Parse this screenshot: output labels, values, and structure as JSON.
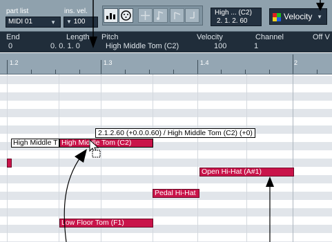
{
  "toolbar": {
    "part_list_label": "part list",
    "part_list_value": "MIDI 01",
    "ins_vel_label": "ins. vel.",
    "ins_vel_value": "100",
    "position_label": "High ... (C2)",
    "position_value": "2. 1. 2. 60",
    "controller_select": "Velocity"
  },
  "info_line": {
    "columns": [
      "End",
      "Length",
      "Pitch",
      "Velocity",
      "Channel",
      "Off V"
    ],
    "values": {
      "end": "0",
      "length": "0. 0. 1.   0",
      "pitch": "High Middle Tom (C2)",
      "velocity": "100",
      "channel": "1"
    }
  },
  "ruler": {
    "ticks": [
      "1.2",
      "1.3",
      "1.4",
      "2"
    ]
  },
  "editor": {
    "tooltip": "2.1.2.60 (+0.0.0.60) / High Middle Tom (C2) (+0)",
    "notes": {
      "ghost": "High Middle T",
      "dragged": "High Middle Tom (C2)",
      "open_hihat": "Open Hi-Hat (A#1)",
      "pedal_hihat": "Pedal Hi-Hat",
      "low_floor_tom": "Low Floor Tom (F1)"
    }
  },
  "colors": {
    "note": "#c9144a",
    "toolbar": "#8fa1ad",
    "info_bg": "#202d3a"
  },
  "icons": [
    "dropdown-arrow-icon",
    "step-input-icon",
    "midi-input-icon",
    "move-insert-icon",
    "pitch-icon",
    "note-on-icon",
    "note-off-icon",
    "velocity-color-icon",
    "copy-cursor-icon",
    "annotation-arrow-icon"
  ]
}
